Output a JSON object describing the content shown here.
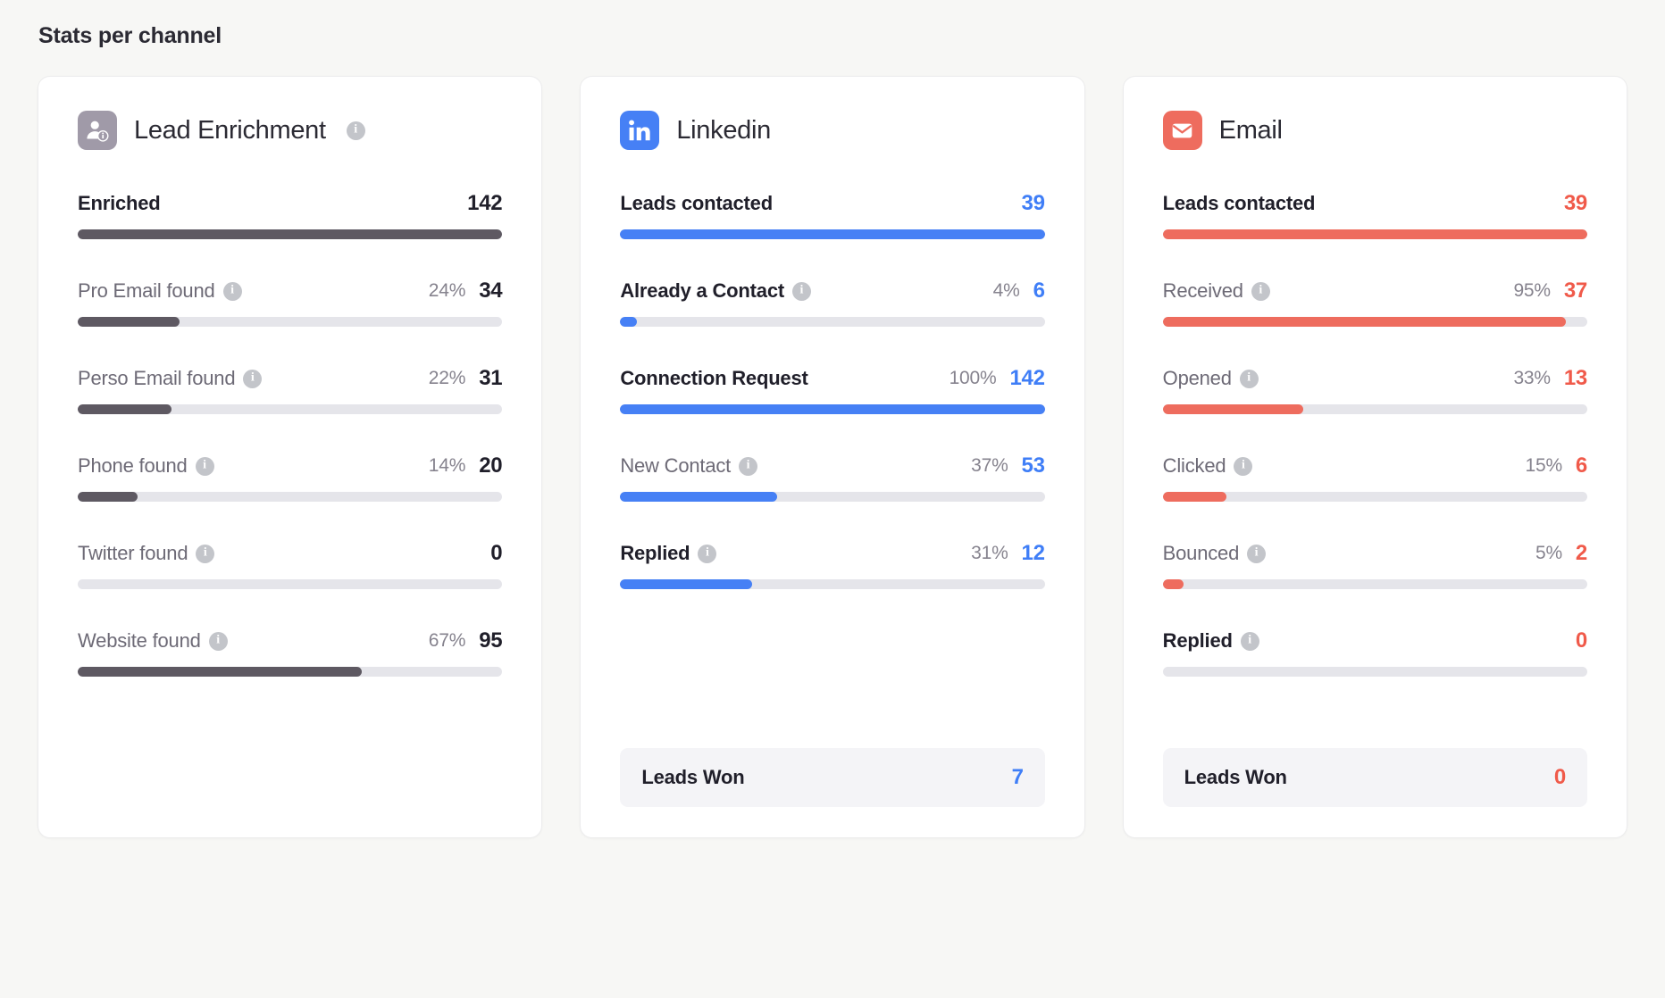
{
  "header": {
    "title": "Stats per channel"
  },
  "colors": {
    "page_bg": "#f7f7f5",
    "card_bg": "#ffffff",
    "enrichment_accent": "#5e5962",
    "linkedin_accent": "#4680f5",
    "email_accent": "#ee6c5e",
    "bar_track": "#e5e5ea",
    "leads_won_bg": "#f4f4f7"
  },
  "chart_data": {
    "type": "bar",
    "title": "Stats per channel",
    "ylabel": "",
    "xlabel": "",
    "ylim": [
      0,
      100
    ],
    "note": "Three channel panels; each metric is a horizontal progress bar whose fill equals the percentage value.",
    "panels": [
      {
        "name": "Lead Enrichment",
        "accent": "#5e5962",
        "categories": [
          "Enriched",
          "Pro Email found",
          "Perso Email found",
          "Phone found",
          "Twitter found",
          "Website found"
        ],
        "percent": [
          100,
          24,
          22,
          14,
          0,
          67
        ],
        "counts": [
          142,
          34,
          31,
          20,
          0,
          95
        ]
      },
      {
        "name": "Linkedin",
        "accent": "#4680f5",
        "categories": [
          "Leads contacted",
          "Already a Contact",
          "Connection Request",
          "New Contact",
          "Replied",
          "Leads Won"
        ],
        "percent": [
          100,
          4,
          100,
          37,
          31,
          null
        ],
        "counts": [
          39,
          6,
          142,
          53,
          12,
          7
        ]
      },
      {
        "name": "Email",
        "accent": "#ee6c5e",
        "categories": [
          "Leads contacted",
          "Received",
          "Opened",
          "Clicked",
          "Bounced",
          "Replied",
          "Leads Won"
        ],
        "percent": [
          100,
          95,
          33,
          15,
          5,
          0,
          null
        ],
        "counts": [
          39,
          37,
          13,
          6,
          2,
          0,
          0
        ]
      }
    ]
  },
  "cards": [
    {
      "id": "lead-enrichment",
      "title": "Lead Enrichment",
      "icon": "user-info-icon",
      "title_info": "info-icon",
      "accent_class": "dark",
      "value_class": "val-dark",
      "rows": [
        {
          "label": "Enriched",
          "info": false,
          "percent": "",
          "value": "142",
          "fill": 100,
          "primary": true
        },
        {
          "label": "Pro Email found",
          "info": true,
          "percent": "24%",
          "value": "34",
          "fill": 24,
          "primary": false
        },
        {
          "label": "Perso Email found",
          "info": true,
          "percent": "22%",
          "value": "31",
          "fill": 22,
          "primary": false
        },
        {
          "label": "Phone found",
          "info": true,
          "percent": "14%",
          "value": "20",
          "fill": 14,
          "primary": false
        },
        {
          "label": "Twitter found",
          "info": true,
          "percent": "",
          "value": "0",
          "fill": 0,
          "primary": false
        },
        {
          "label": "Website found",
          "info": true,
          "percent": "67%",
          "value": "95",
          "fill": 67,
          "primary": false
        }
      ],
      "leads_won": null
    },
    {
      "id": "linkedin",
      "title": "Linkedin",
      "icon": "linkedin-icon",
      "title_info": null,
      "accent_class": "blue",
      "value_class": "val-blue",
      "rows": [
        {
          "label": "Leads contacted",
          "info": false,
          "percent": "",
          "value": "39",
          "fill": 100,
          "primary": true
        },
        {
          "label": "Already a Contact",
          "info": true,
          "percent": "4%",
          "value": "6",
          "fill": 4,
          "primary": true
        },
        {
          "label": "Connection Request",
          "info": false,
          "percent": "100%",
          "value": "142",
          "fill": 100,
          "primary": true
        },
        {
          "label": "New Contact",
          "info": true,
          "percent": "37%",
          "value": "53",
          "fill": 37,
          "primary": false
        },
        {
          "label": "Replied",
          "info": true,
          "percent": "31%",
          "value": "12",
          "fill": 31,
          "primary": true
        }
      ],
      "leads_won": {
        "label": "Leads Won",
        "value": "7"
      }
    },
    {
      "id": "email",
      "title": "Email",
      "icon": "envelope-icon",
      "title_info": null,
      "accent_class": "red",
      "value_class": "val-red",
      "rows": [
        {
          "label": "Leads contacted",
          "info": false,
          "percent": "",
          "value": "39",
          "fill": 100,
          "primary": true
        },
        {
          "label": "Received",
          "info": true,
          "percent": "95%",
          "value": "37",
          "fill": 95,
          "primary": false
        },
        {
          "label": "Opened",
          "info": true,
          "percent": "33%",
          "value": "13",
          "fill": 33,
          "primary": false
        },
        {
          "label": "Clicked",
          "info": true,
          "percent": "15%",
          "value": "6",
          "fill": 15,
          "primary": false
        },
        {
          "label": "Bounced",
          "info": true,
          "percent": "5%",
          "value": "2",
          "fill": 5,
          "primary": false
        },
        {
          "label": "Replied",
          "info": true,
          "percent": "",
          "value": "0",
          "fill": 0,
          "primary": true
        }
      ],
      "leads_won": {
        "label": "Leads Won",
        "value": "0"
      }
    }
  ]
}
